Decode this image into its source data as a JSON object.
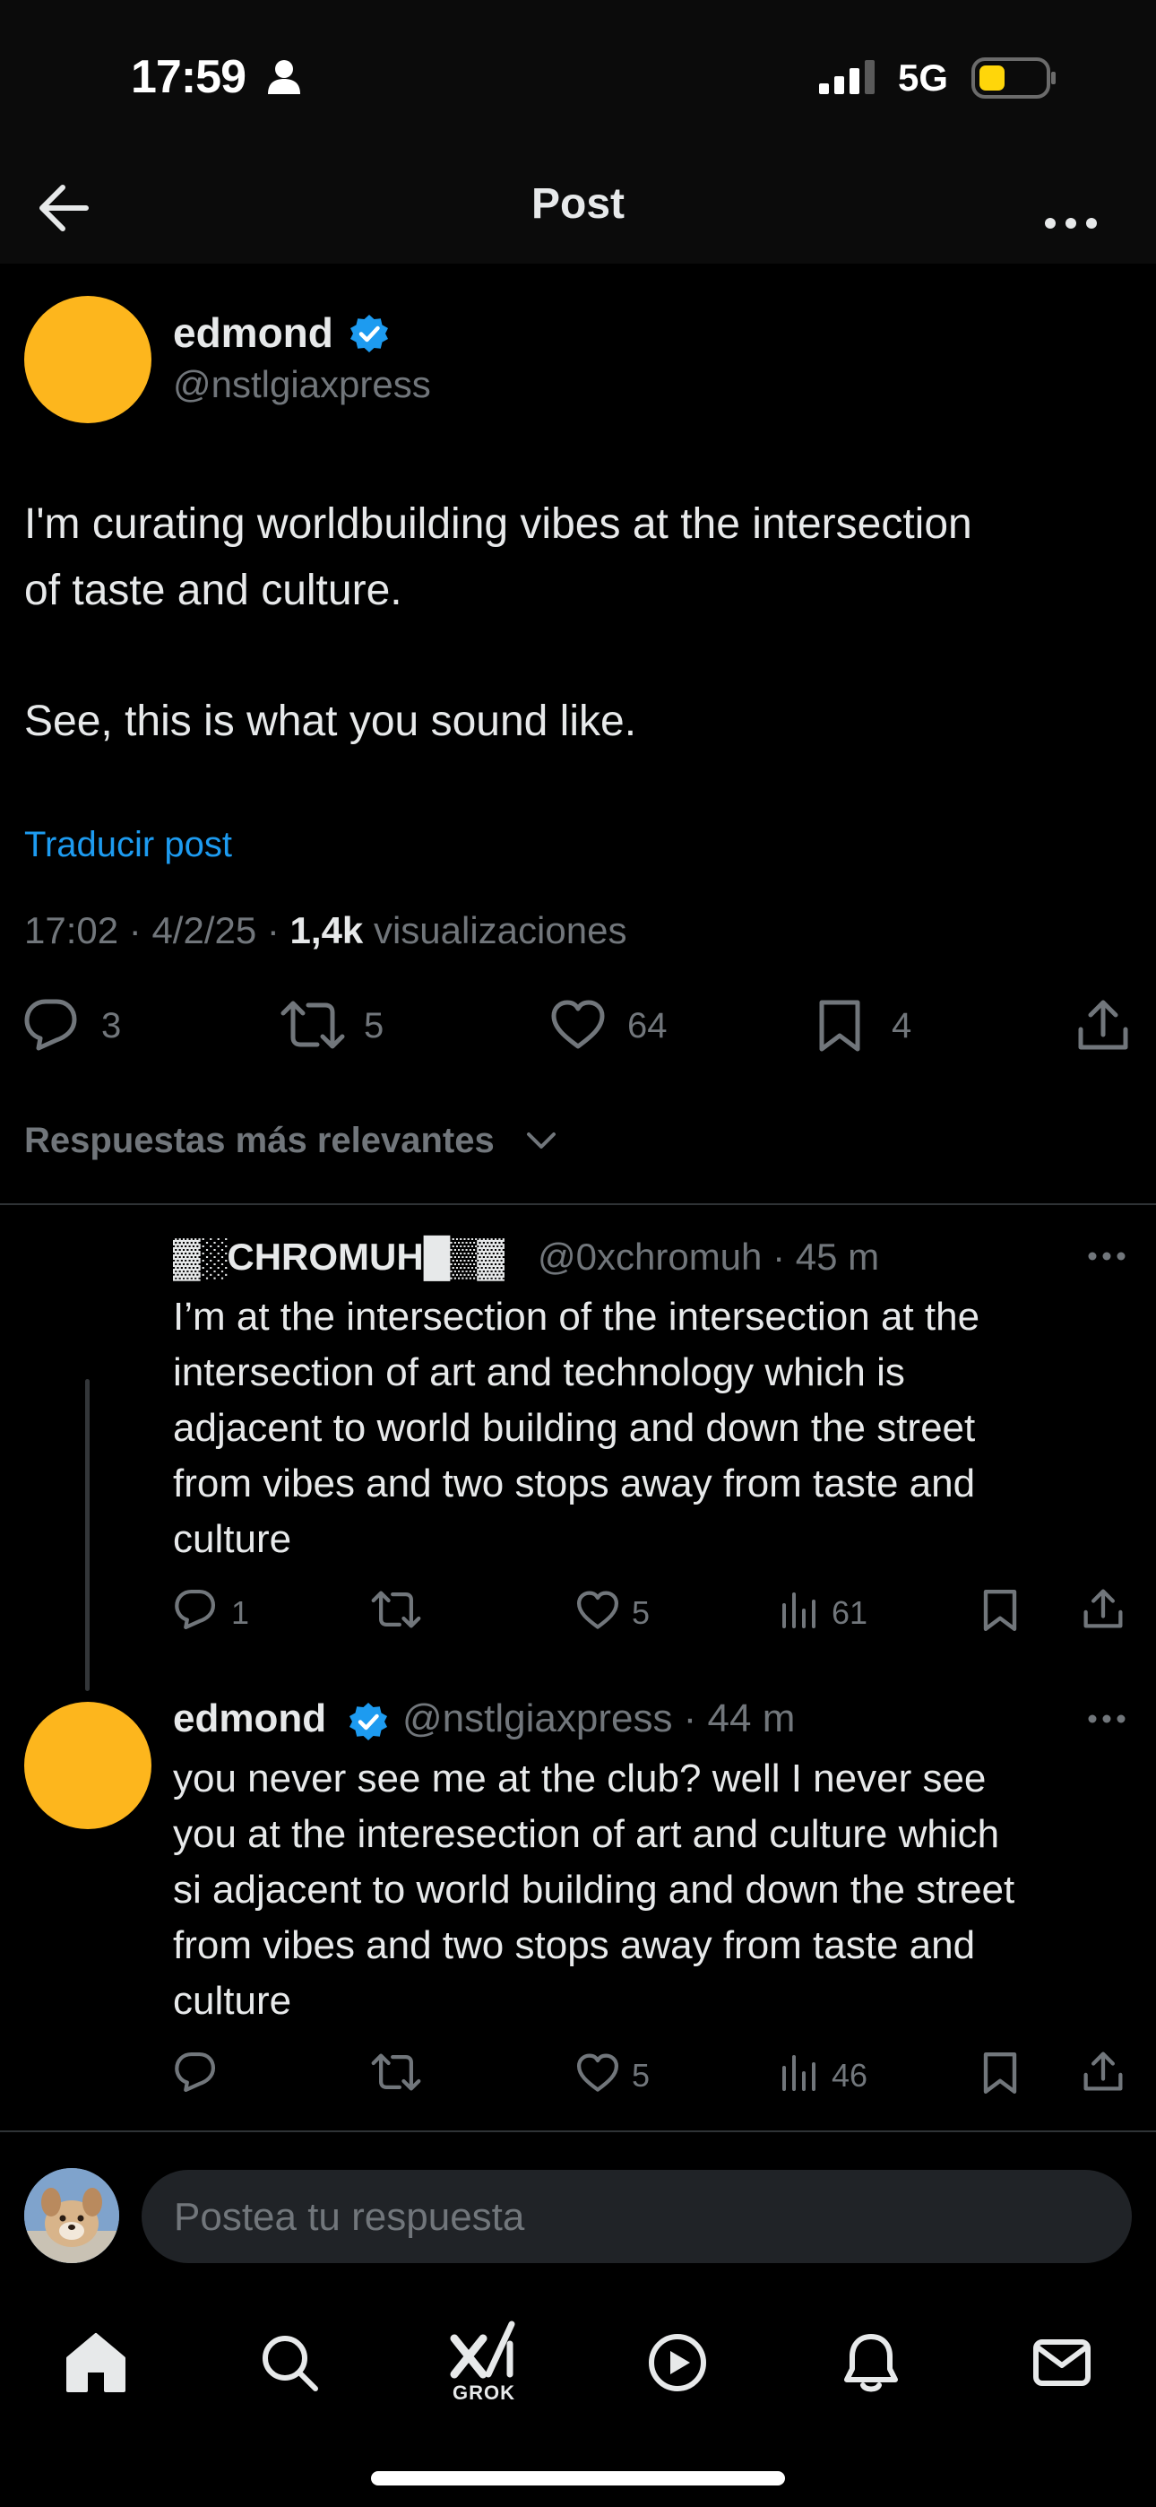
{
  "status_bar": {
    "time": "17:59",
    "network": "5G",
    "icons": [
      "person-icon",
      "signal-icon",
      "battery-icon"
    ],
    "battery_color": "#FFD60A"
  },
  "header": {
    "title": "Post",
    "back_icon": "arrow-left-icon",
    "more_icon": "more-horizontal-icon"
  },
  "post": {
    "author": "edmond",
    "handle": "@nstlgiaxpress",
    "avatar_color": "#FDB61D",
    "verified": true,
    "text_lines": [
      "I'm curating worldbuilding vibes at the intersection",
      "of taste and culture.",
      "See, this is what you sound like."
    ],
    "translate_label": "Traducir post",
    "time": "17:02",
    "date": "4/2/25",
    "views_count": "1,4k",
    "views_label": "visualizaciones",
    "actions": {
      "replies": "3",
      "reposts": "5",
      "likes": "64",
      "bookmarks": "4"
    }
  },
  "replies_sort": {
    "label": "Respuestas más relevantes"
  },
  "replies": [
    {
      "author": "▓░CHROMUH█▒▓",
      "handle_time": "@0xchromuh · 45 m",
      "text_lines": [
        "I’m at the intersection of the intersection at the",
        "intersection of art and technology which is",
        "adjacent to world building and down the street",
        "from vibes and two stops away from taste and",
        "culture"
      ],
      "actions": {
        "replies": "1",
        "reposts": "",
        "likes": "5",
        "views": "61"
      }
    },
    {
      "author": "edmond",
      "handle_time": "@nstlgiaxpress · 44 m",
      "verified": true,
      "text_lines": [
        "you never see me at the club? well I never see",
        "you at the interesection of art and culture which",
        "si adjacent to world building and down the street",
        "from vibes and two stops away from taste and",
        "culture"
      ],
      "actions": {
        "replies": "",
        "reposts": "",
        "likes": "5",
        "views": "46"
      }
    }
  ],
  "composer": {
    "placeholder": "Postea tu respuesta"
  },
  "tabbar": {
    "tabs": [
      "home-icon",
      "search-icon",
      "grok-icon",
      "video-icon",
      "notifications-icon",
      "messages-icon"
    ],
    "grok_label": "GROK"
  },
  "colors": {
    "accent": "#1D9BF0",
    "muted": "#71767B",
    "text": "#E7E9EA",
    "background": "#000000"
  }
}
